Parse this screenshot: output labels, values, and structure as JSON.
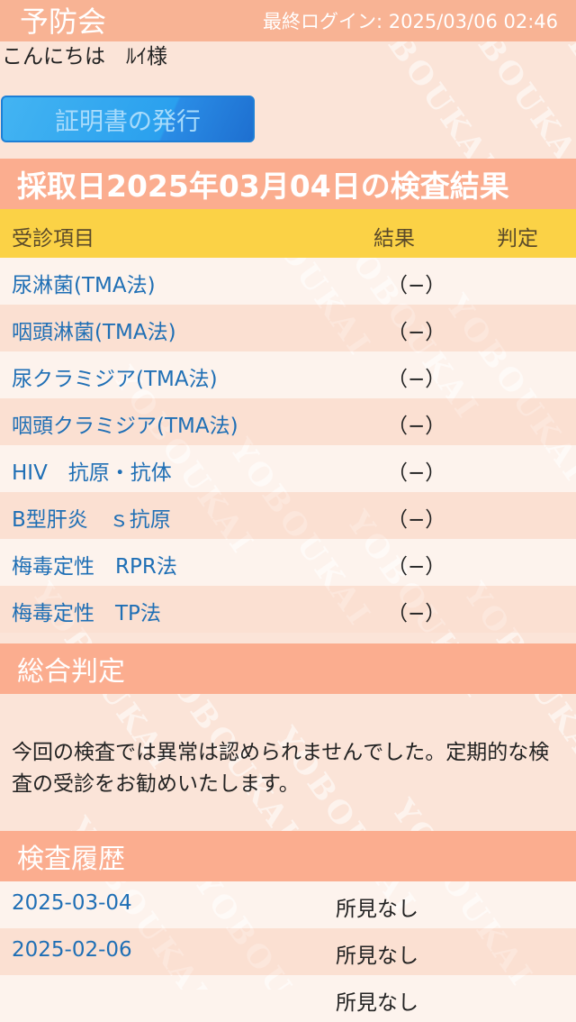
{
  "header": {
    "logo": "予防会",
    "last_login": "最終ログイン: 2025/03/06 02:46"
  },
  "greeting": "こんにちは　ﾙｲ様",
  "certificate_button": "証明書の発行",
  "results": {
    "title": "採取日2025年03月04日の検査結果",
    "columns": {
      "item": "受診項目",
      "result": "結果",
      "judgement": "判定"
    },
    "rows": [
      {
        "item": "尿淋菌(TMA法)",
        "result": "（−）",
        "judgement": ""
      },
      {
        "item": "咽頭淋菌(TMA法)",
        "result": "（−）",
        "judgement": ""
      },
      {
        "item": "尿クラミジア(TMA法)",
        "result": "（−）",
        "judgement": ""
      },
      {
        "item": "咽頭クラミジア(TMA法)",
        "result": "（−）",
        "judgement": ""
      },
      {
        "item": "HIV　抗原・抗体",
        "result": "（−）",
        "judgement": ""
      },
      {
        "item": "B型肝炎　ｓ抗原",
        "result": "（−）",
        "judgement": ""
      },
      {
        "item": "梅毒定性　RPR法",
        "result": "（−）",
        "judgement": ""
      },
      {
        "item": "梅毒定性　TP法",
        "result": "（−）",
        "judgement": ""
      }
    ]
  },
  "overall": {
    "title": "総合判定",
    "text": "今回の検査では異常は認められませんでした。定期的な検査の受診をお勧めいたします。"
  },
  "history": {
    "title": "検査履歴",
    "rows": [
      {
        "date": "2025-03-04",
        "finding": "所見なし"
      },
      {
        "date": "2025-02-06",
        "finding": "所見なし"
      },
      {
        "date": "",
        "finding": "所見なし"
      }
    ]
  },
  "watermark_text": "YOBOUKAI",
  "colors": {
    "header_bar": "#f8b394",
    "section_header": "#fbad8f",
    "column_header": "#fbd246",
    "link_text": "#1f6fb5",
    "button": "#2aa0ee"
  }
}
